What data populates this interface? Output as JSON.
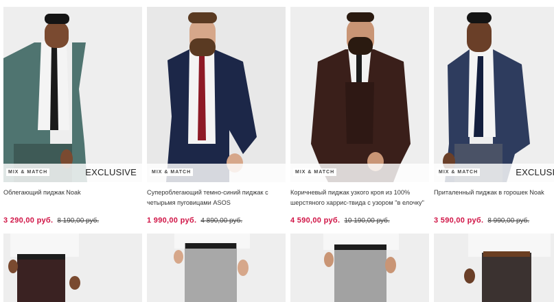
{
  "products": [
    {
      "badge": "MIX & MATCH",
      "tag": "EXCLUSIVE",
      "title": "Облегающий пиджак Noak",
      "price": "3 290,00 руб.",
      "old_price": "8 190,00 руб.",
      "colors": {
        "bg": "#eeeeee",
        "suit": "#4f7470",
        "shirt": "#f4f4f4",
        "tie": "#1a1a1a",
        "skin": "#7a4a30",
        "hair": "#141414"
      }
    },
    {
      "badge": "MIX & MATCH",
      "tag": "",
      "title": "Супероблегающий темно-синий пиджак с четырьмя пуговицами ASOS",
      "price": "1 990,00 руб.",
      "old_price": "4 890,00 руб.",
      "colors": {
        "bg": "#e8e8e8",
        "suit": "#1c2748",
        "shirt": "#f4f4f4",
        "tie": "#8e1a26",
        "skin": "#d6a78a",
        "hair": "#5a3a22"
      }
    },
    {
      "badge": "MIX & MATCH",
      "tag": "",
      "title": "Коричневый пиджак узкого кроя из 100% шерстяного харрис-твида с узором \"в елочку\"",
      "price": "4 590,00 руб.",
      "old_price": "10 190,00 руб.",
      "colors": {
        "bg": "#eeeeee",
        "suit": "#3a1f1a",
        "shirt": "#f2f2f2",
        "tie": "#1c1c1c",
        "skin": "#c99575",
        "hair": "#2a1a10"
      }
    },
    {
      "badge": "MIX & MATCH",
      "tag": "EXCLUSIVE",
      "title": "Приталенный пиджак в горошек Noak",
      "price": "3 590,00 руб.",
      "old_price": "8 990,00 руб.",
      "colors": {
        "bg": "#eeeeee",
        "suit": "#2e3c5e",
        "shirt": "#f4f4f4",
        "tie": "#141f3e",
        "skin": "#6a3f28",
        "hair": "#141414"
      }
    }
  ],
  "pants_row": [
    {
      "colors": {
        "bg": "#eeeeee",
        "shirt": "#f7f7f7",
        "pants": "#3a2222",
        "belt": "#1d1d1d",
        "skin": "#7a4a30"
      }
    },
    {
      "colors": {
        "bg": "#eeeeee",
        "shirt": "#f7f7f7",
        "pants": "#a8a8a8",
        "belt": "#1d1d1d",
        "skin": "#d6a78a"
      }
    },
    {
      "colors": {
        "bg": "#eeeeee",
        "shirt": "#f7f7f7",
        "pants": "#a2a2a2",
        "belt": "#1d1d1d",
        "skin": "#c99575"
      }
    },
    {
      "colors": {
        "bg": "#eeeeee",
        "shirt": "#f7f7f7",
        "pants": "#3b3230",
        "belt": "#6b3f22",
        "skin": "#6a3f28"
      }
    }
  ]
}
